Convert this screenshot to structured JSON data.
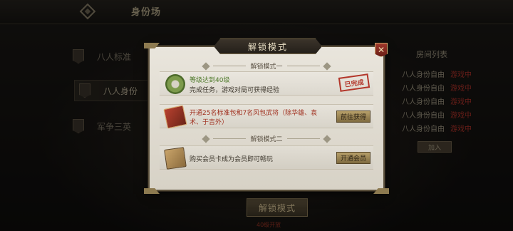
{
  "screen": {
    "title": "身份场"
  },
  "left_menu": [
    {
      "label": "八人标准"
    },
    {
      "label": "八人身份"
    },
    {
      "label": "军争三英"
    }
  ],
  "room_list": {
    "header": "房间列表",
    "rows": [
      {
        "name": "八人身份自由",
        "status": "游戏中"
      },
      {
        "name": "八人身份自由",
        "status": "游戏中"
      },
      {
        "name": "八人身份自由",
        "status": "游戏中"
      },
      {
        "name": "八人身份自由",
        "status": "游戏中"
      },
      {
        "name": "八人身份自由",
        "status": "游戏中"
      }
    ],
    "join_label": "加入"
  },
  "bottom": {
    "unlock_label": "解锁模式",
    "note": "40级开放"
  },
  "modal": {
    "title": "解锁模式",
    "close_symbol": "✕",
    "section1": "解锁模式一",
    "section2": "解锁模式二",
    "task1": {
      "title": "等级达到40级",
      "desc": "完成任务，游戏对局可获得经验",
      "status": "已完成"
    },
    "task2": {
      "desc": "开通25名标准包和7名风包武将（除华雄、袁术、于吉外）",
      "button": "前往获得"
    },
    "task3": {
      "desc": "购买会员卡成为会员即可畅玩",
      "button": "开通会员"
    }
  },
  "colors": {
    "accent_red": "#a0301f",
    "accent_green": "#4f7a2b",
    "panel_bg": "#e2ded4",
    "frame_gold": "#8d7a50"
  }
}
